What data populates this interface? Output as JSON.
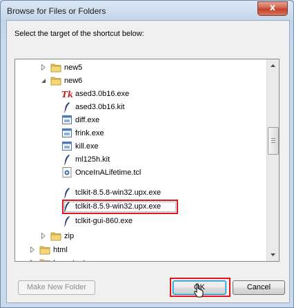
{
  "window": {
    "title": "Browse for Files or Folders",
    "close_glyph": "x"
  },
  "dialog": {
    "instruction": "Select the target of the shortcut below:"
  },
  "tree": {
    "items": [
      {
        "label": "new5",
        "icon": "folder-icon",
        "expander": "collapsed"
      },
      {
        "label": "new6",
        "icon": "folder-icon",
        "expander": "expanded"
      },
      {
        "label": "ased3.0b16.exe",
        "icon": "tcl-app-icon"
      },
      {
        "label": "ased3.0b16.kit",
        "icon": "feather-icon"
      },
      {
        "label": "diff.exe",
        "icon": "exe-icon"
      },
      {
        "label": "frink.exe",
        "icon": "exe-icon"
      },
      {
        "label": "kill.exe",
        "icon": "exe-icon"
      },
      {
        "label": "ml125h.kit",
        "icon": "feather-icon"
      },
      {
        "label": "OnceInALifetime.tcl",
        "icon": "tcl-script-icon"
      },
      {
        "label": "tclkit-8.5.8-win32.upx.exe",
        "icon": "feather-icon"
      },
      {
        "label": "tclkit-8.5.9-win32.upx.exe",
        "icon": "feather-icon",
        "selected": true
      },
      {
        "label": "tclkit-gui-860.exe",
        "icon": "feather-icon"
      },
      {
        "label": "zip",
        "icon": "folder-icon",
        "expander": "collapsed"
      },
      {
        "label": "html",
        "icon": "folder-icon",
        "expander": "collapsed"
      },
      {
        "label": "Important ...",
        "icon": "folder-icon",
        "expander": "collapsed"
      }
    ]
  },
  "buttons": {
    "make_new_folder": "Make New Folder",
    "ok": "OK",
    "cancel": "Cancel"
  },
  "colors": {
    "highlight_outline": "#e2141c",
    "selection_focus": "#888888"
  }
}
